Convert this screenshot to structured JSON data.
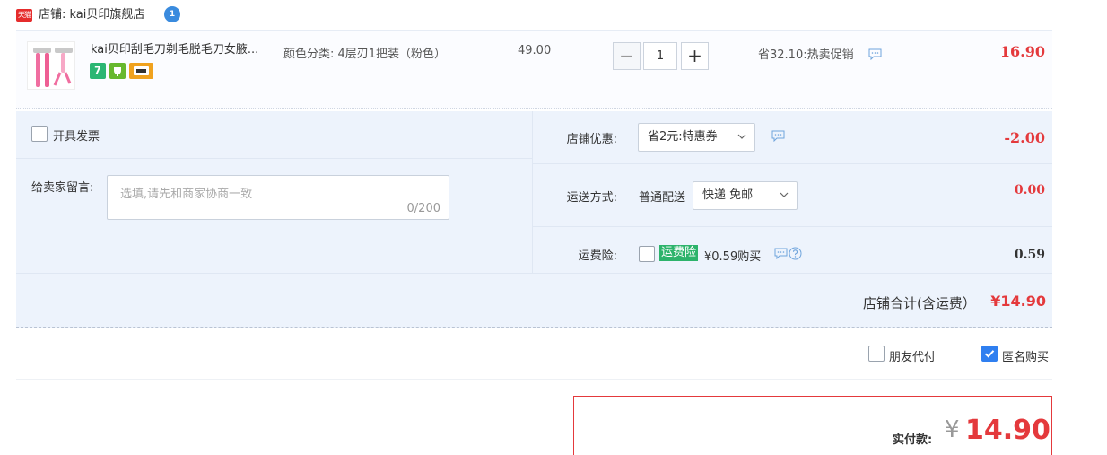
{
  "store": {
    "logo_text": "天猫",
    "name_label": "店铺: kai贝印旗舰店",
    "chat_badge": "1"
  },
  "product": {
    "title": "kai贝印刮毛刀剃毛脱毛刀女腋...",
    "badges": [
      "7",
      "",
      ""
    ],
    "sku_label": "颜色分类: 4层刃1把装（粉色）",
    "unit_price": "49.00",
    "quantity": "1",
    "minus_symbol": "−",
    "plus_symbol": "+",
    "promo_text": "省32.10:热卖促销",
    "item_total": "16.90"
  },
  "options": {
    "invoice_label": "开具发票",
    "message_label": "给卖家留言:",
    "message_placeholder": "选填,请先和商家协商一致",
    "message_count": "0/200",
    "coupon_label": "店铺优惠:",
    "coupon_selected": "省2元:特惠券",
    "coupon_amount": "-2.00",
    "shipping_label": "运送方式:",
    "shipping_method": "普通配送",
    "shipping_selected": "快递 免邮",
    "shipping_amount": "0.00",
    "insurance_label": "运费险:",
    "insurance_badge": "运费险",
    "insurance_price": "¥0.59购买",
    "insurance_amount": "0.59",
    "store_total_label": "店铺合计(含运费）",
    "store_total_amount": "¥14.90"
  },
  "checkout": {
    "friend_pay_label": "朋友代付",
    "anonymous_label": "匿名购买",
    "pay_label": "实付款:",
    "pay_currency": "¥",
    "pay_amount": "14.90"
  },
  "colors": {
    "accent_red": "#e4393c",
    "options_bg": "#edf3fc",
    "checkbox_blue": "#2f7ff0",
    "insurance_green": "#2db36b"
  }
}
